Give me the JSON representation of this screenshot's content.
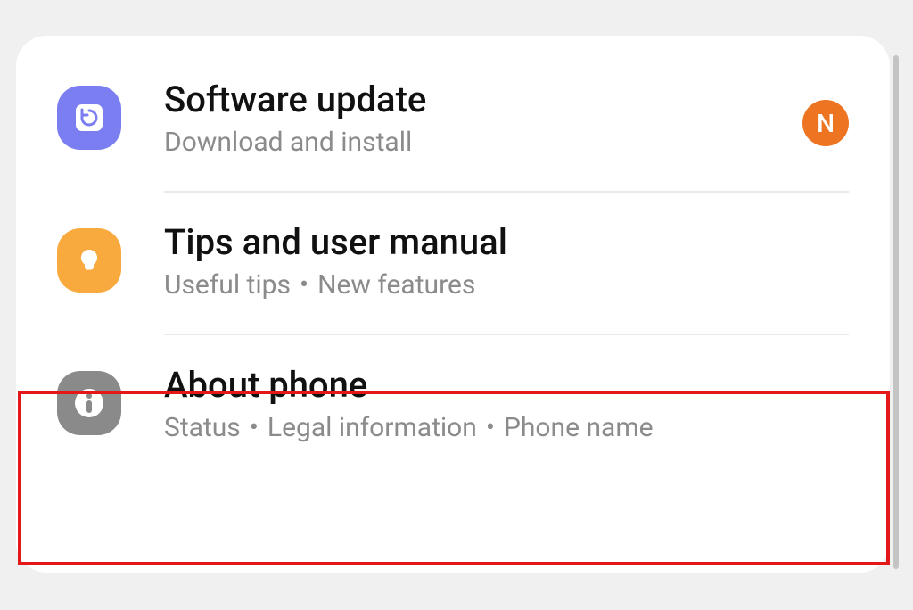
{
  "badge": {
    "initial": "N"
  },
  "items": [
    {
      "title": "Software update",
      "subtitle_parts": [
        "Download and install"
      ],
      "icon": "refresh",
      "color": "purple",
      "has_badge": true
    },
    {
      "title": "Tips and user manual",
      "subtitle_parts": [
        "Useful tips",
        "New features"
      ],
      "icon": "bulb",
      "color": "orange",
      "has_badge": false
    },
    {
      "title": "About phone",
      "subtitle_parts": [
        "Status",
        "Legal information",
        "Phone name"
      ],
      "icon": "info",
      "color": "gray",
      "has_badge": false,
      "highlighted": true
    }
  ]
}
